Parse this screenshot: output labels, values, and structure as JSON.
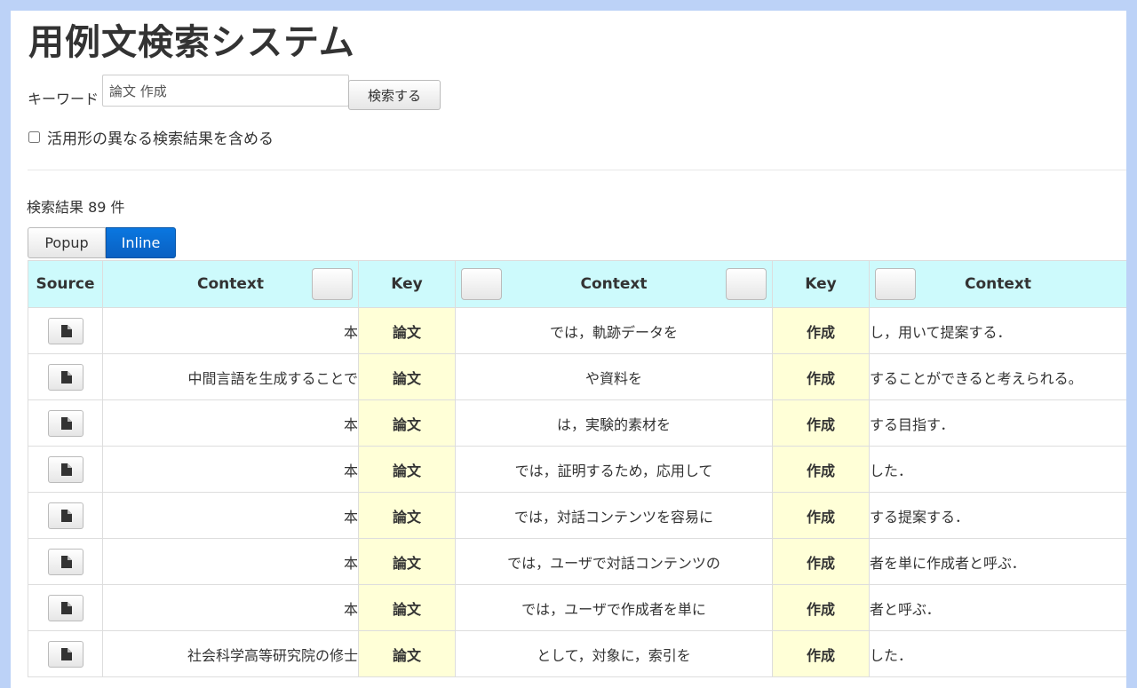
{
  "title": "用例文検索システム",
  "search": {
    "label": "キーワード",
    "value": "論文 作成",
    "button": "検索する"
  },
  "inflection_option": {
    "label": "活用形の異なる検索結果を含める",
    "checked": false
  },
  "results": {
    "count_text": "検索結果 89 件",
    "view_modes": [
      "Popup",
      "Inline"
    ],
    "active_view": "Inline"
  },
  "table": {
    "headers": {
      "source": "Source",
      "context1": "Context",
      "key1": "Key",
      "context2": "Context",
      "key2": "Key",
      "context3": "Context"
    },
    "rows": [
      {
        "c1": "本",
        "k1": "論文",
        "c2": "では，軌跡データを",
        "k2": "作成",
        "c3": "し，用いて提案する．"
      },
      {
        "c1": "中間言語を生成することで",
        "k1": "論文",
        "c2": "や資料を",
        "k2": "作成",
        "c3": "することができると考えられる。"
      },
      {
        "c1": "本",
        "k1": "論文",
        "c2": "は，実験的素材を",
        "k2": "作成",
        "c3": "する目指す．"
      },
      {
        "c1": "本",
        "k1": "論文",
        "c2": "では，証明するため，応用して",
        "k2": "作成",
        "c3": "した．"
      },
      {
        "c1": "本",
        "k1": "論文",
        "c2": "では，対話コンテンツを容易に",
        "k2": "作成",
        "c3": "する提案する．"
      },
      {
        "c1": "本",
        "k1": "論文",
        "c2": "では，ユーザで対話コンテンツの",
        "k2": "作成",
        "c3": "者を単に作成者と呼ぶ．"
      },
      {
        "c1": "本",
        "k1": "論文",
        "c2": "では，ユーザで作成者を単に",
        "k2": "作成",
        "c3": "者と呼ぶ．"
      },
      {
        "c1": "社会科学高等研究院の修士",
        "k1": "論文",
        "c2": "として，対象に，索引を",
        "k2": "作成",
        "c3": "した．"
      }
    ]
  },
  "icons": {
    "source_button": "document-icon"
  },
  "colors": {
    "page_frame": "#bcd2f7",
    "header_bg": "#cdfafc",
    "key_bg": "#ffffd7",
    "key_text": "#1010d8",
    "active_toggle": "#0a6ad2"
  }
}
